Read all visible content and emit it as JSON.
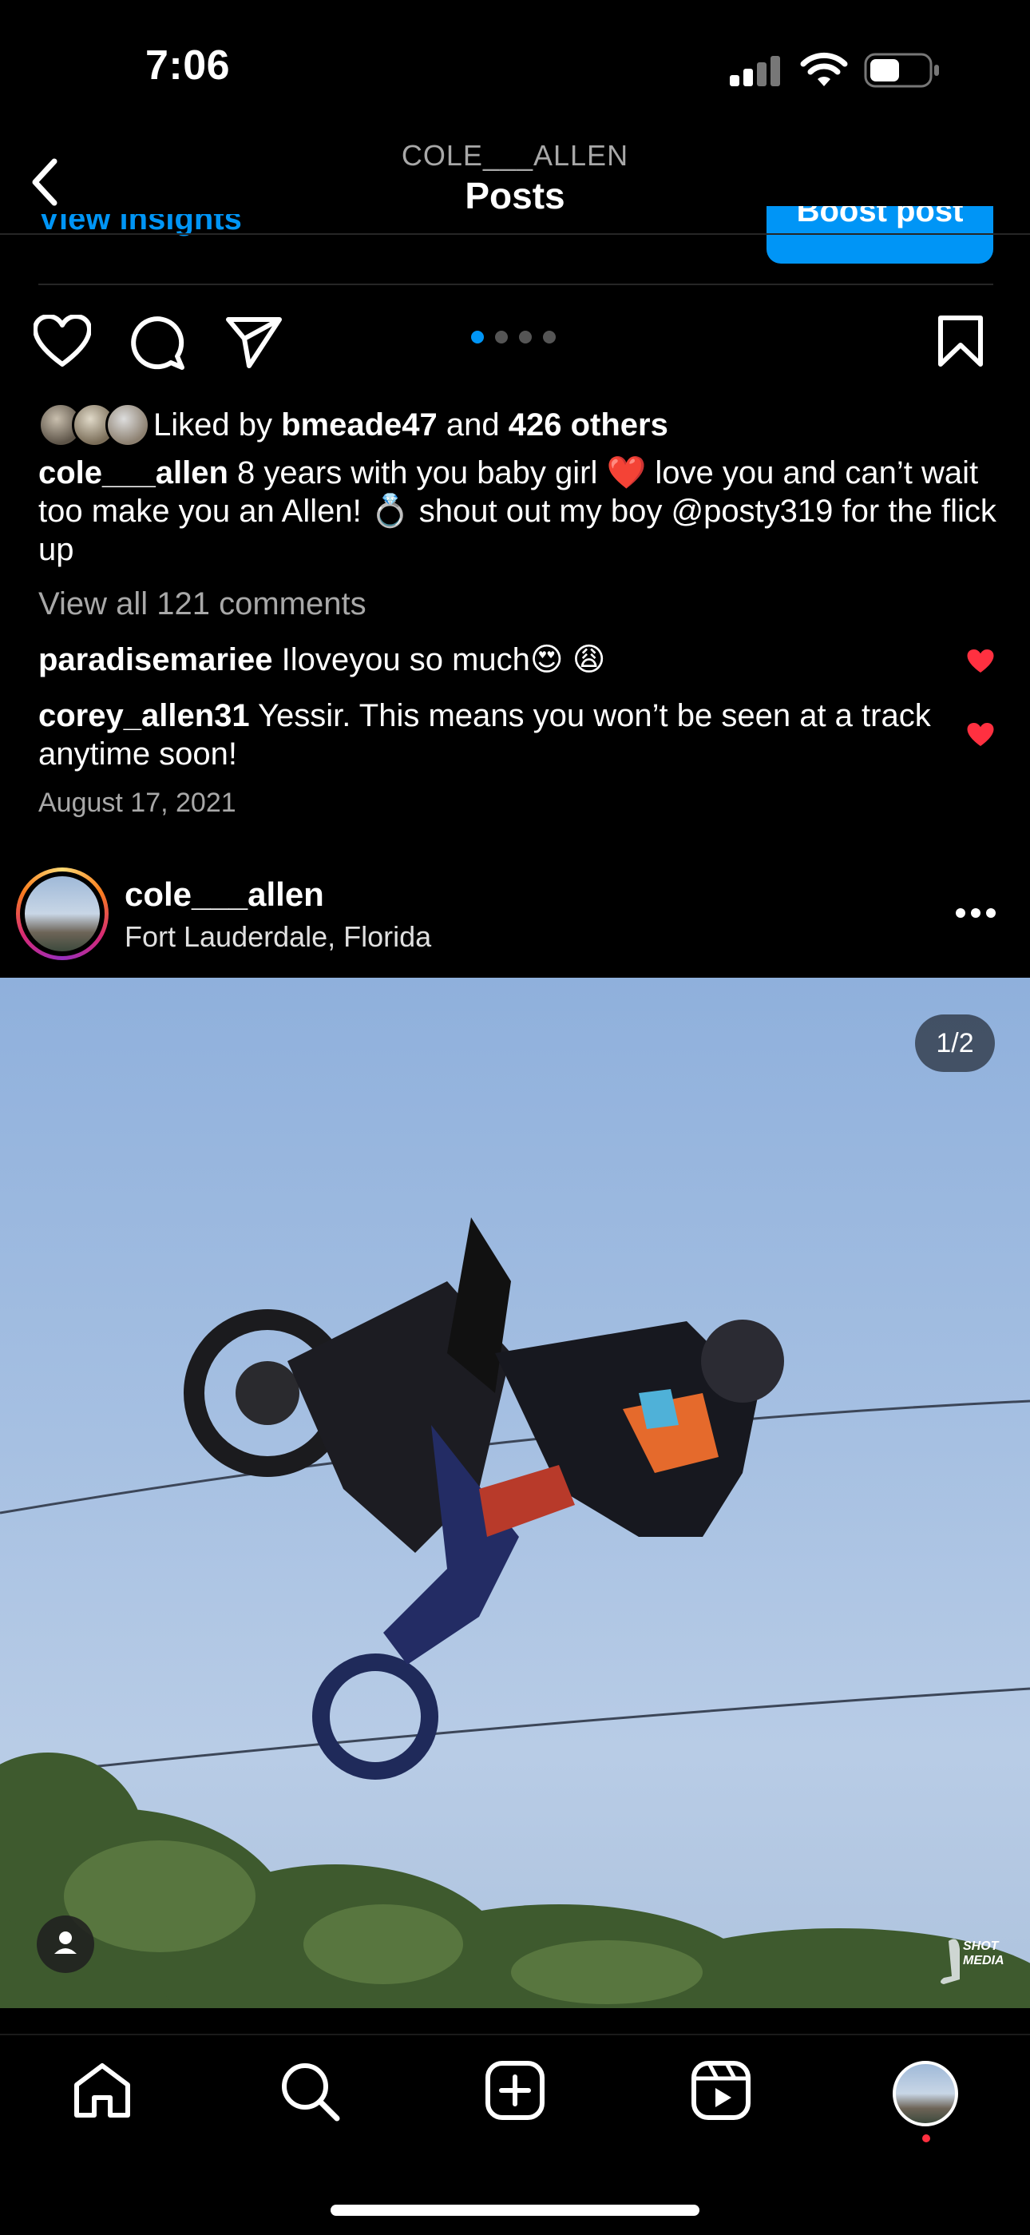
{
  "status_bar": {
    "time": "7:06"
  },
  "header": {
    "username": "COLE___ALLEN",
    "title": "Posts"
  },
  "prev_post": {
    "view_insights": "View insights",
    "boost_label": "Boost post",
    "likes": {
      "prefix": "Liked by ",
      "user": "bmeade47",
      "middle": " and ",
      "others": "426 others"
    },
    "caption": {
      "user": "cole___allen",
      "text": " 8 years with you baby girl ❤️ love you and can’t wait too make you an Allen! 💍 shout out my boy @posty319 for the flick up"
    },
    "view_comments": "View all 121 comments",
    "comments": [
      {
        "user": "paradisemariee",
        "text": " Iloveyou so much😍 😩"
      },
      {
        "user": "corey_allen31",
        "text": " Yessir. This means you won’t be seen at a track anytime soon!"
      }
    ],
    "date": "August 17, 2021"
  },
  "next_post": {
    "username": "cole___allen",
    "location": "Fort Lauderdale, Florida",
    "counter": "1/2",
    "watermark": "SHOT MEDIA"
  },
  "colors": {
    "accent": "#0095f6",
    "like_red": "#ff3040",
    "bg": "#000000"
  },
  "icons": [
    "back-icon",
    "heart-icon",
    "comment-icon",
    "share-icon",
    "bookmark-icon",
    "more-icon",
    "person-tag-icon",
    "home-icon",
    "search-icon",
    "create-icon",
    "reels-icon"
  ]
}
